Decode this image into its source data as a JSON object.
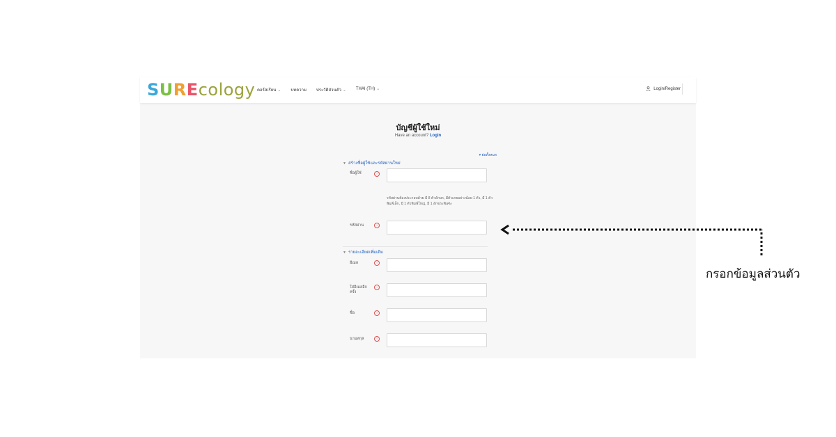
{
  "logo": {
    "s": "S",
    "u": "U",
    "r": "R",
    "e": "E",
    "rest": "cology"
  },
  "nav": {
    "items": [
      {
        "label": "คอร์สเรียน",
        "dropdown": true
      },
      {
        "label": "บทความ",
        "dropdown": false
      },
      {
        "label": "ประวัติส่วนตัว",
        "dropdown": true
      },
      {
        "label": "THAI (TH)",
        "dropdown": true
      }
    ],
    "chevron": "⌄",
    "login_label": "Login/Register"
  },
  "page": {
    "title": "บัญชีผู้ใช้ใหม่",
    "have_account": "Have an account?",
    "login_link": "Login",
    "collapse_all": "▾ ย่อทั้งหมด"
  },
  "sections": {
    "account": "สร้างชื่อผู้ใช้และรหัสผ่านใหม่",
    "details": "รายละเอียดเพิ่มเติม"
  },
  "fields": {
    "username": {
      "label": "ชื่อผู้ใช้",
      "value": ""
    },
    "password_hint": "รหัสผ่านต้องประกอบด้วย มี 8 ตัวอักษร, มีตัวเลขอย่างน้อย 1 ตัว, มี 1 ตัวพิมพ์เล็ก, มี 1 ตัวพิมพ์ใหญ่, มี 1 อักขระพิเศษ",
    "password": {
      "label": "รหัสผ่าน",
      "value": ""
    },
    "email": {
      "label": "อีเมล",
      "value": ""
    },
    "email_again": {
      "label": "ใส่อีเมลอีก ครั้ง",
      "value": ""
    },
    "first_name": {
      "label": "ชื่อ",
      "value": ""
    },
    "last_name": {
      "label": "นามสกุล",
      "value": ""
    }
  },
  "required_icon": "!",
  "annotation": "กรอกข้อมูลส่วนตัว",
  "colors": {
    "link": "#1f5fbf",
    "required": "#e05050",
    "panel_bg": "#f7f7f7"
  }
}
